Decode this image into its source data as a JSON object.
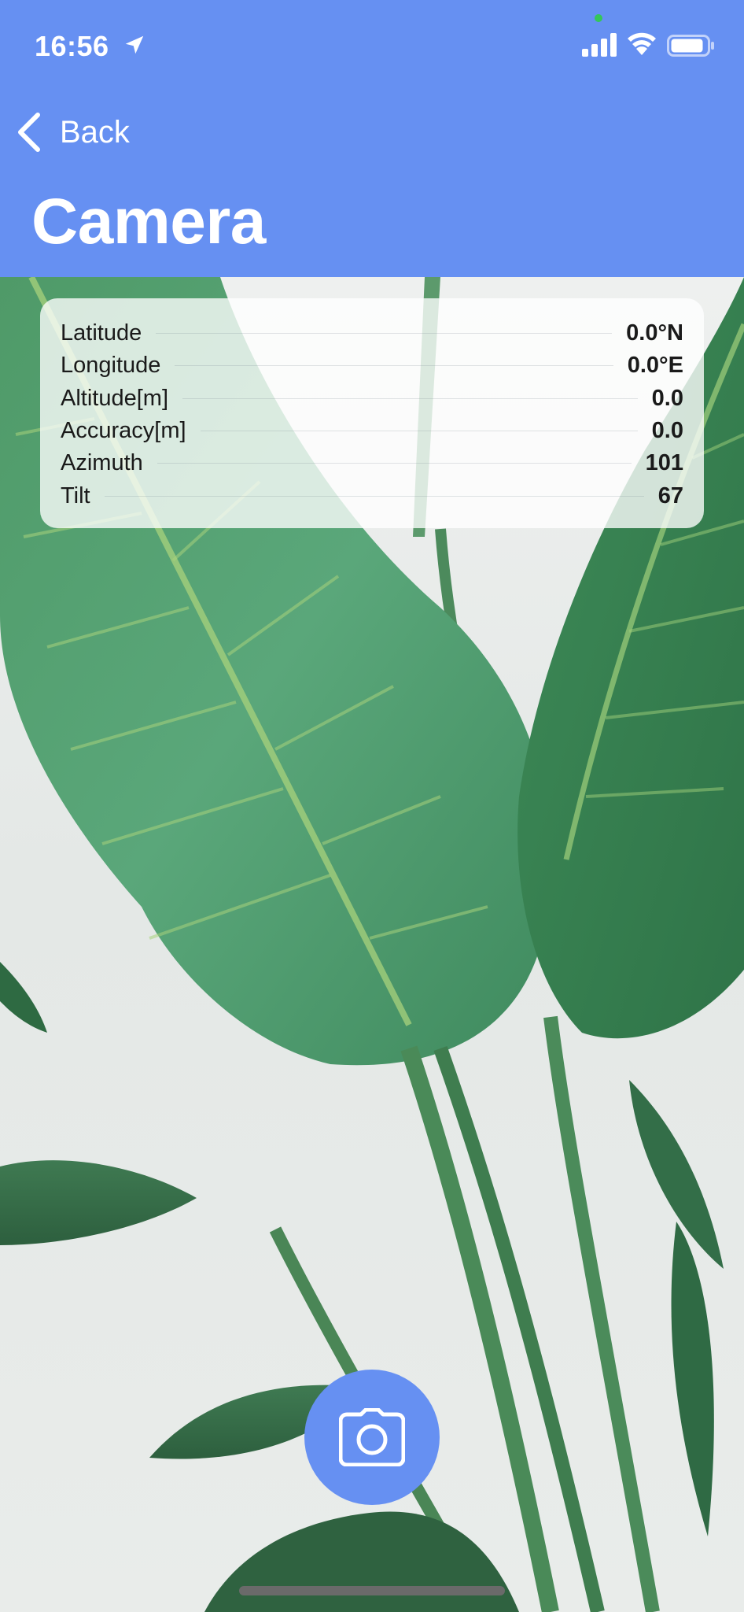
{
  "status_bar": {
    "time": "16:56",
    "icons": [
      "location-arrow-icon",
      "signal-bars-icon",
      "wifi-icon",
      "battery-icon"
    ]
  },
  "nav": {
    "back_label": "Back",
    "title": "Camera"
  },
  "info": {
    "rows": [
      {
        "label": "Latitude",
        "value": "0.0°N"
      },
      {
        "label": "Longitude",
        "value": "0.0°E"
      },
      {
        "label": "Altitude[m]",
        "value": "0.0"
      },
      {
        "label": "Accuracy[m]",
        "value": "0.0"
      },
      {
        "label": "Azimuth",
        "value": "101"
      },
      {
        "label": "Tilt",
        "value": "67"
      }
    ]
  },
  "shutter": {
    "icon": "camera-icon"
  },
  "colors": {
    "accent": "#6690f2",
    "header_text": "#ffffff"
  }
}
